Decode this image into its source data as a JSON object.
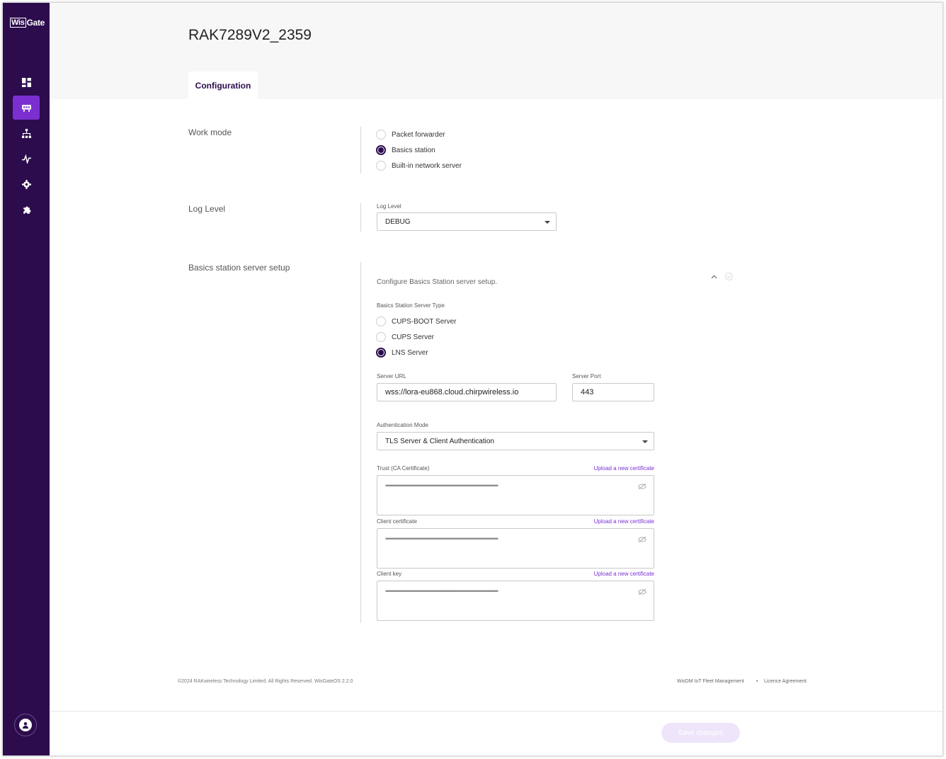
{
  "app": {
    "logo_boxed": "Wis",
    "logo_rest": "Gate"
  },
  "sidebar": {
    "items": [
      {
        "name": "dashboard-icon",
        "active": false
      },
      {
        "name": "gateway-icon",
        "active": true
      },
      {
        "name": "network-icon",
        "active": false
      },
      {
        "name": "activity-icon",
        "active": false
      },
      {
        "name": "settings-icon",
        "active": false
      },
      {
        "name": "extensions-icon",
        "active": false
      }
    ],
    "avatar_icon": "user-icon"
  },
  "header": {
    "title": "RAK7289V2_2359",
    "tab": "Configuration"
  },
  "work_mode": {
    "label": "Work mode",
    "options": [
      "Packet forwarder",
      "Basics station",
      "Built-in network server"
    ],
    "selected": "Basics station"
  },
  "log_level": {
    "label": "Log Level",
    "field_label": "Log Level",
    "value": "DEBUG"
  },
  "basics_station": {
    "label": "Basics station server setup",
    "helper": "Configure Basics Station server setup.",
    "server_type_label": "Basics Station Server Type",
    "server_types": [
      "CUPS-BOOT Server",
      "CUPS Server",
      "LNS Server"
    ],
    "selected_type": "LNS Server",
    "server_url_label": "Server URL",
    "server_url": "wss://lora-eu868.cloud.chirpwireless.io",
    "server_port_label": "Server Port",
    "server_port": "443",
    "auth_mode_label": "Authentication Mode",
    "auth_mode": "TLS Server & Client Authentication",
    "trust_label": "Trust (CA Certificate)",
    "client_cert_label": "Client certificate",
    "client_key_label": "Client key",
    "upload_link": "Upload a new certificate",
    "masked": "••••••••••••••••••••••••••••••••••••••••••••••••••••••••••••••••••••••••••••••••••••••••••••••••"
  },
  "footer": {
    "copyright": "©2024 RAKwireless Technology Limited. All Rights Reserved. WisGateOS 2.2.0",
    "link1": "WisDM IoT Fleet Management",
    "link2": "Licence Agreement"
  },
  "actions": {
    "save": "Save changes"
  },
  "colors": {
    "sidebar": "#2c0c4d",
    "accent": "#7b2fd1"
  }
}
